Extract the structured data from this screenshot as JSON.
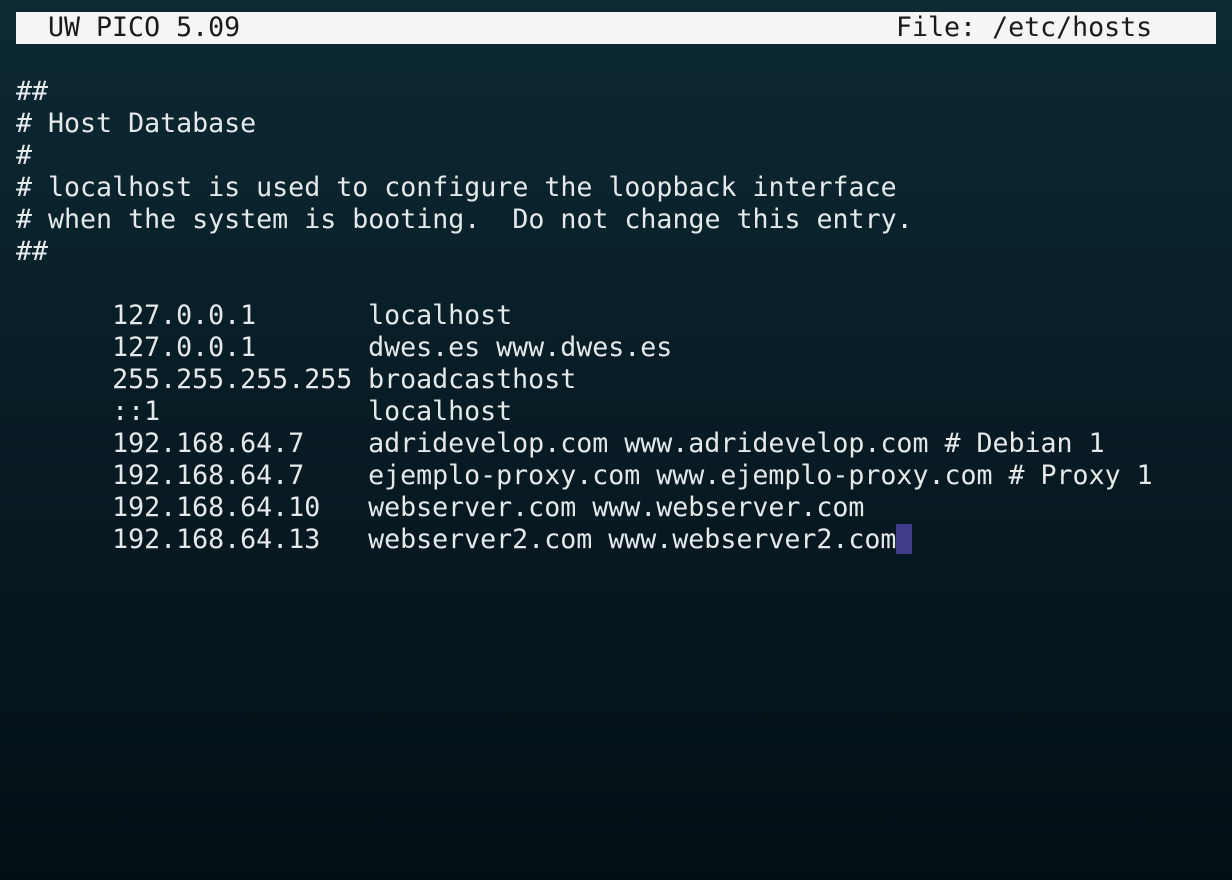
{
  "title_bar": {
    "app_name": "UW PICO 5.09",
    "file_label": "File: /etc/hosts"
  },
  "comments": [
    "##",
    "# Host Database",
    "#",
    "# localhost is used to configure the loopback interface",
    "# when the system is booting.  Do not change this entry.",
    "##"
  ],
  "entries": [
    {
      "ip": "127.0.0.1",
      "hosts": "localhost"
    },
    {
      "ip": "127.0.0.1",
      "hosts": "dwes.es www.dwes.es"
    },
    {
      "ip": "255.255.255.255",
      "hosts": "broadcasthost"
    },
    {
      "ip": "::1",
      "hosts": "localhost"
    },
    {
      "ip": "192.168.64.7",
      "hosts": "adridevelop.com www.adridevelop.com # Debian 1"
    },
    {
      "ip": "192.168.64.7",
      "hosts": "ejemplo-proxy.com www.ejemplo-proxy.com # Proxy 1"
    },
    {
      "ip": "192.168.64.10",
      "hosts": "webserver.com www.webserver.com"
    },
    {
      "ip": "192.168.64.13",
      "hosts": "webserver2.com www.webserver2.com"
    }
  ],
  "colors": {
    "cursor": "#3f3d8a",
    "title_bar_bg": "#f5f5f5",
    "text": "#e6e9ea"
  }
}
